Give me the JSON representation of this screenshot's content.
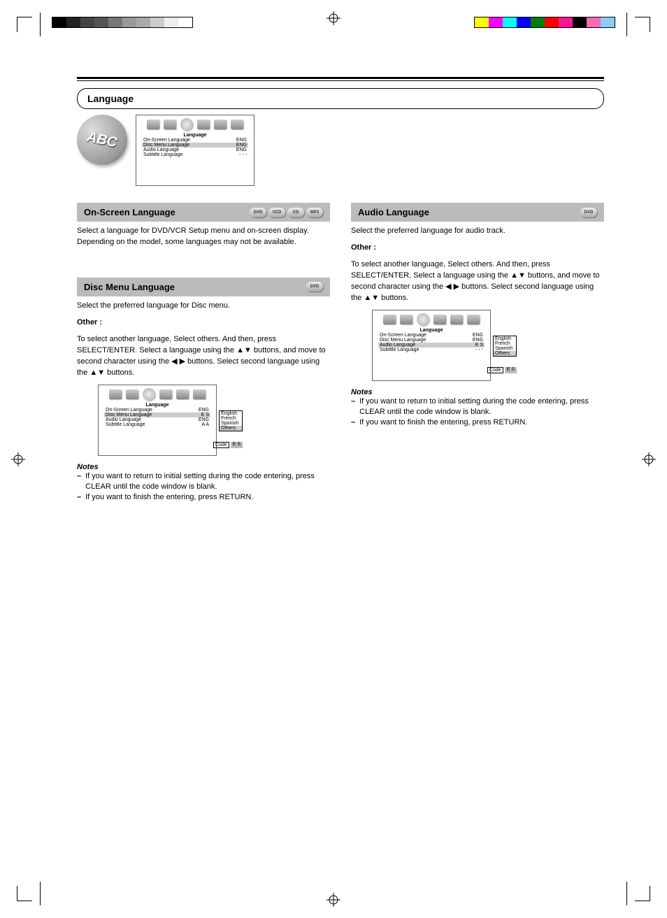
{
  "crop": {
    "grayShades": [
      "#000",
      "#222",
      "#444",
      "#555",
      "#777",
      "#999",
      "#aaa",
      "#ccc",
      "#eee",
      "#fff"
    ],
    "colors": [
      "#ffff00",
      "#ff00ff",
      "#00ffff",
      "#0000ff",
      "#008000",
      "#ff0000",
      "#ff1493",
      "#000000",
      "#ff69b4",
      "#87cefa"
    ]
  },
  "title": "Language",
  "badgeText": "ABC",
  "osd_main": {
    "heading": "Language",
    "rows": [
      {
        "label": "On-Screen Language",
        "value": "ENG"
      },
      {
        "label": "Disc Menu Language",
        "value": "ENG"
      },
      {
        "label": "Audio Language",
        "value": "ENG"
      },
      {
        "label": "Subtitle Language",
        "value": "- - -"
      }
    ],
    "hlIndex": 1
  },
  "sec_onscreen": {
    "title": "On-Screen Language",
    "discs": [
      "DVD",
      "VCD",
      "CD",
      "MP3"
    ],
    "body": "Select a language for DVD/VCR Setup menu and on-screen display. Depending on the model, some languages may not be available."
  },
  "sec_discmenu": {
    "title": "Disc Menu Language",
    "discs": [
      "DVD"
    ],
    "body": "Select the preferred language for Disc menu.",
    "sub": "Other :",
    "subbody": "To select another language, Select others. And then, press SELECT/ENTER. Select a language using the ▲▼ buttons, and move to second character using the ◀ ▶ buttons. Select second language using the ▲▼ buttons.",
    "osd": {
      "heading": "Language",
      "rows": [
        {
          "label": "On-Screen Language",
          "value": "ENG"
        },
        {
          "label": "Disc Menu Language",
          "value": "E S"
        },
        {
          "label": "Audio Language",
          "value": "ENG"
        },
        {
          "label": "Subtitle Language",
          "value": "A A"
        }
      ],
      "hlIndex": 1,
      "popup": [
        "English",
        "French",
        "Spanish",
        "Others"
      ],
      "popupSel": 3,
      "codeLabel": "Code",
      "codeVal": "E S"
    },
    "notes_head": "Notes",
    "notes": [
      "If you want to return to initial setting during the code entering, press CLEAR until the code window is blank.",
      "If you want to finish the entering, press RETURN."
    ]
  },
  "sec_audio": {
    "title": "Audio Language",
    "discs": [
      "DVD"
    ],
    "body": "Select the preferred language for audio track.",
    "sub": "Other :",
    "subbody": "To select another language, Select others. And then, press SELECT/ENTER. Select a language using the ▲▼ buttons, and move to second character using the ◀ ▶ buttons. Select second language using the ▲▼ buttons.",
    "osd": {
      "heading": "Language",
      "rows": [
        {
          "label": "On-Screen Language",
          "value": "ENG"
        },
        {
          "label": "Disc Menu Language",
          "value": "ENG"
        },
        {
          "label": "Audio Language",
          "value": "E S"
        },
        {
          "label": "Subtitle Language",
          "value": "- - -"
        }
      ],
      "hlIndex": 2,
      "popup": [
        "English",
        "French",
        "Spanish",
        "Others"
      ],
      "popupSel": 3,
      "codeLabel": "Code",
      "codeVal": "E S"
    },
    "notes_head": "Notes",
    "notes": [
      "If you want to return to initial setting during the code entering, press CLEAR until the code window is blank.",
      "If you want to finish the entering, press RETURN."
    ]
  }
}
